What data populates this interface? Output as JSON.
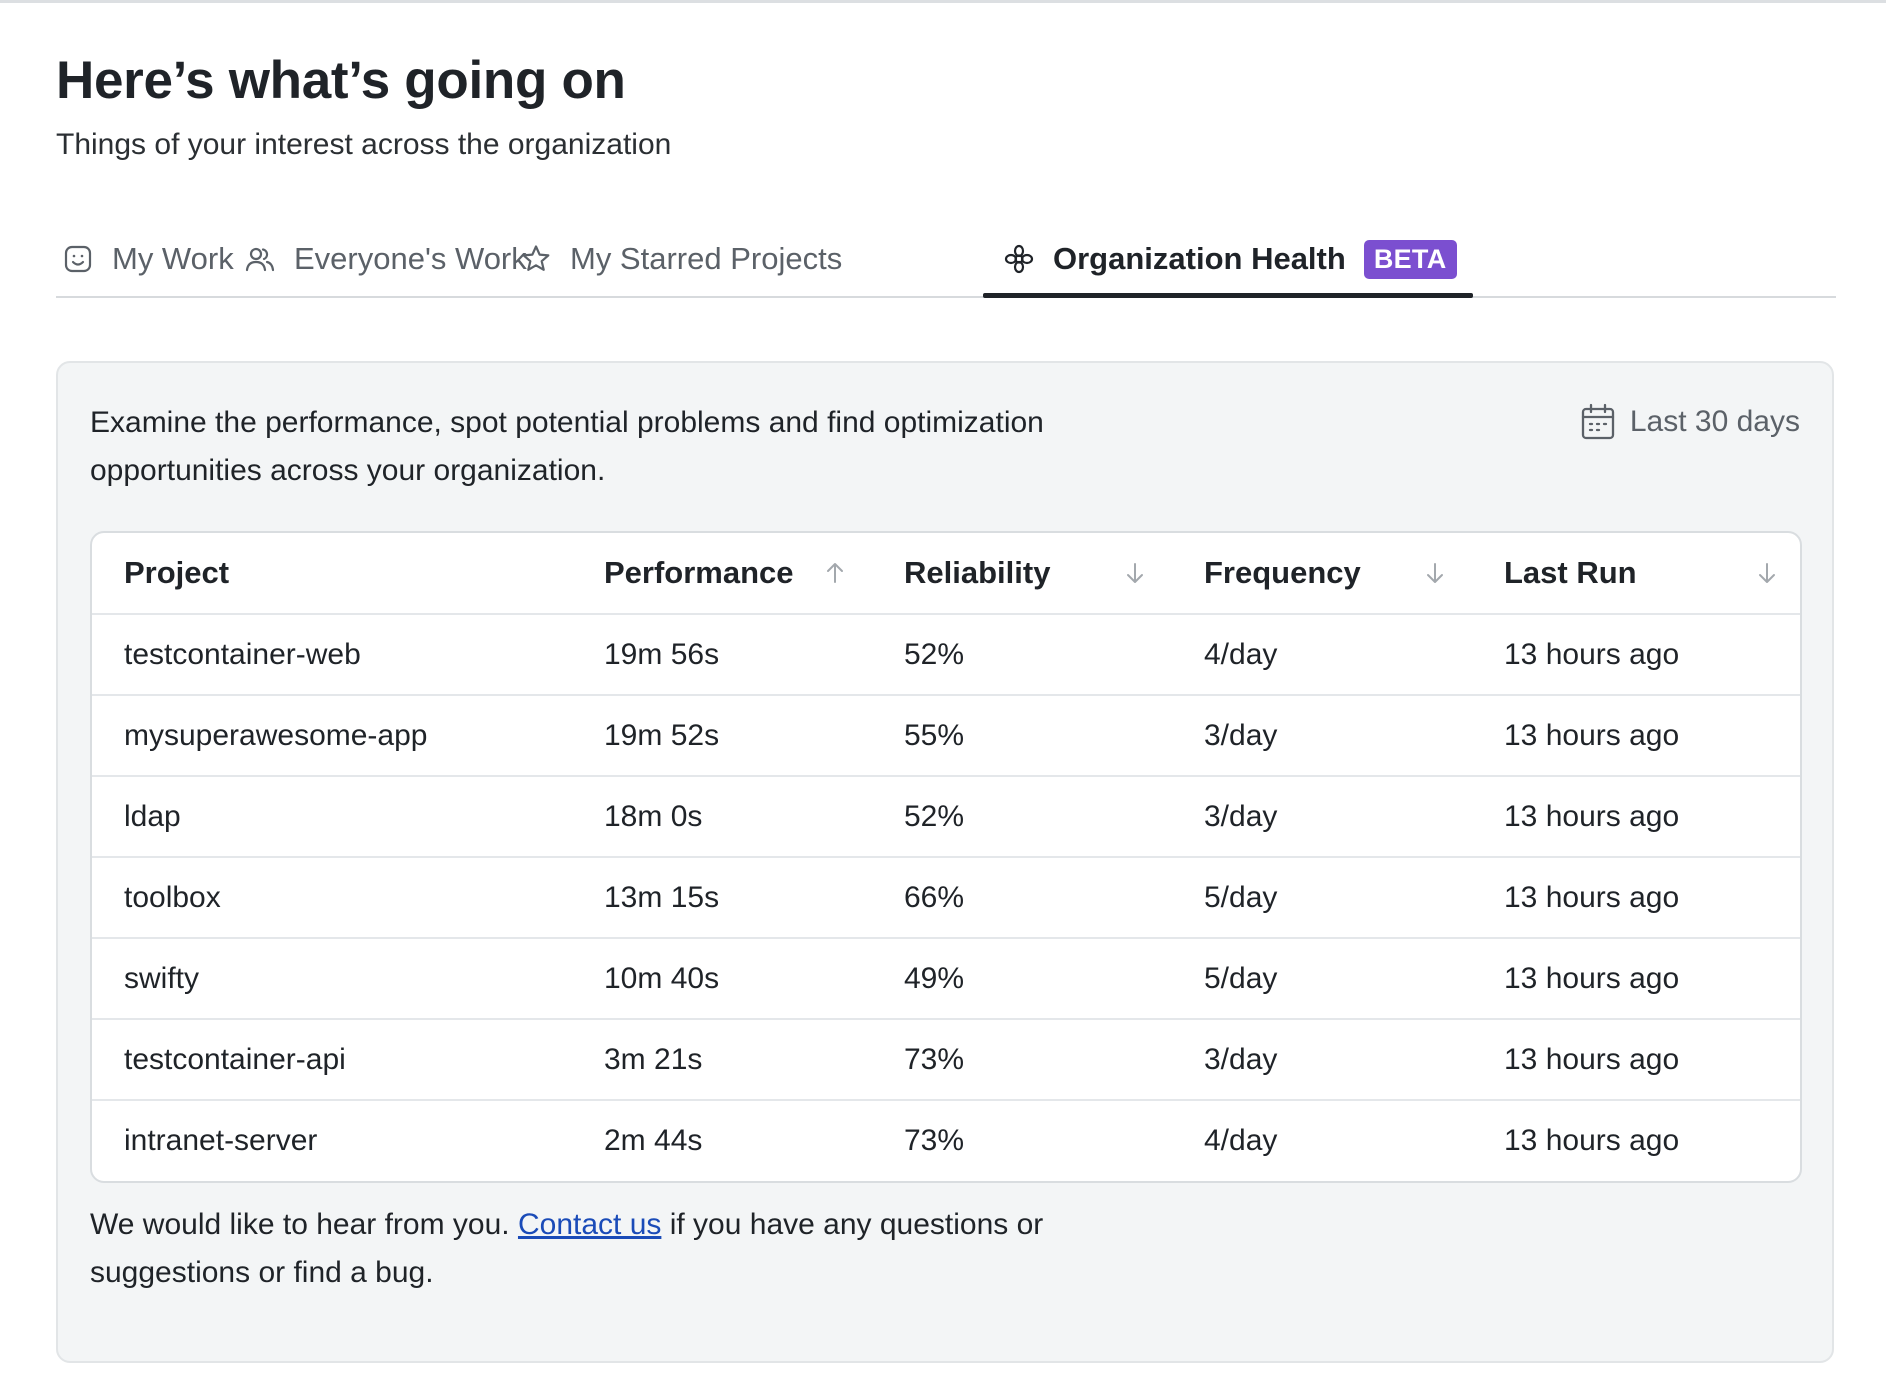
{
  "header": {
    "title": "Here’s what’s going on",
    "subtitle": "Things of your interest across the organization"
  },
  "tabs": [
    {
      "label": "My Work",
      "icon": "smiley-icon",
      "active": false
    },
    {
      "label": "Everyone's Work",
      "icon": "people-icon",
      "active": false
    },
    {
      "label": "My Starred Projects",
      "icon": "star-icon",
      "active": false
    },
    {
      "label": "Organization Health",
      "icon": "flower-icon",
      "active": true,
      "badge": "BETA"
    }
  ],
  "panel": {
    "description": "Examine the performance, spot potential problems and find optimization opportunities across your organization.",
    "range_label": "Last 30 days",
    "range_icon": "calendar-icon"
  },
  "table": {
    "columns": [
      {
        "label": "Project",
        "sort": ""
      },
      {
        "label": "Performance",
        "sort": "ascending"
      },
      {
        "label": "Reliability",
        "sort": "descending"
      },
      {
        "label": "Frequency",
        "sort": "descending"
      },
      {
        "label": "Last Run",
        "sort": "descending"
      }
    ],
    "rows": [
      [
        "testcontainer-web",
        "19m 56s",
        "52%",
        "4/day",
        "13 hours ago"
      ],
      [
        "mysuperawesome-app",
        "19m 52s",
        "55%",
        "3/day",
        "13 hours ago"
      ],
      [
        "ldap",
        "18m 0s",
        "52%",
        "3/day",
        "13 hours ago"
      ],
      [
        "toolbox",
        "13m 15s",
        "66%",
        "5/day",
        "13 hours ago"
      ],
      [
        "swifty",
        "10m 40s",
        "49%",
        "5/day",
        "13 hours ago"
      ],
      [
        "testcontainer-api",
        "3m 21s",
        "73%",
        "3/day",
        "13 hours ago"
      ],
      [
        "intranet-server",
        "2m 44s",
        "73%",
        "4/day",
        "13 hours ago"
      ]
    ]
  },
  "feedback": {
    "before": "We would like to hear from you. ",
    "link": "Contact us",
    "after": " if you have any questions or suggestions or find a bug."
  },
  "colors": {
    "badge": "#7b4fd0",
    "link": "#1a4bb8",
    "panel_bg": "#f3f5f6"
  }
}
